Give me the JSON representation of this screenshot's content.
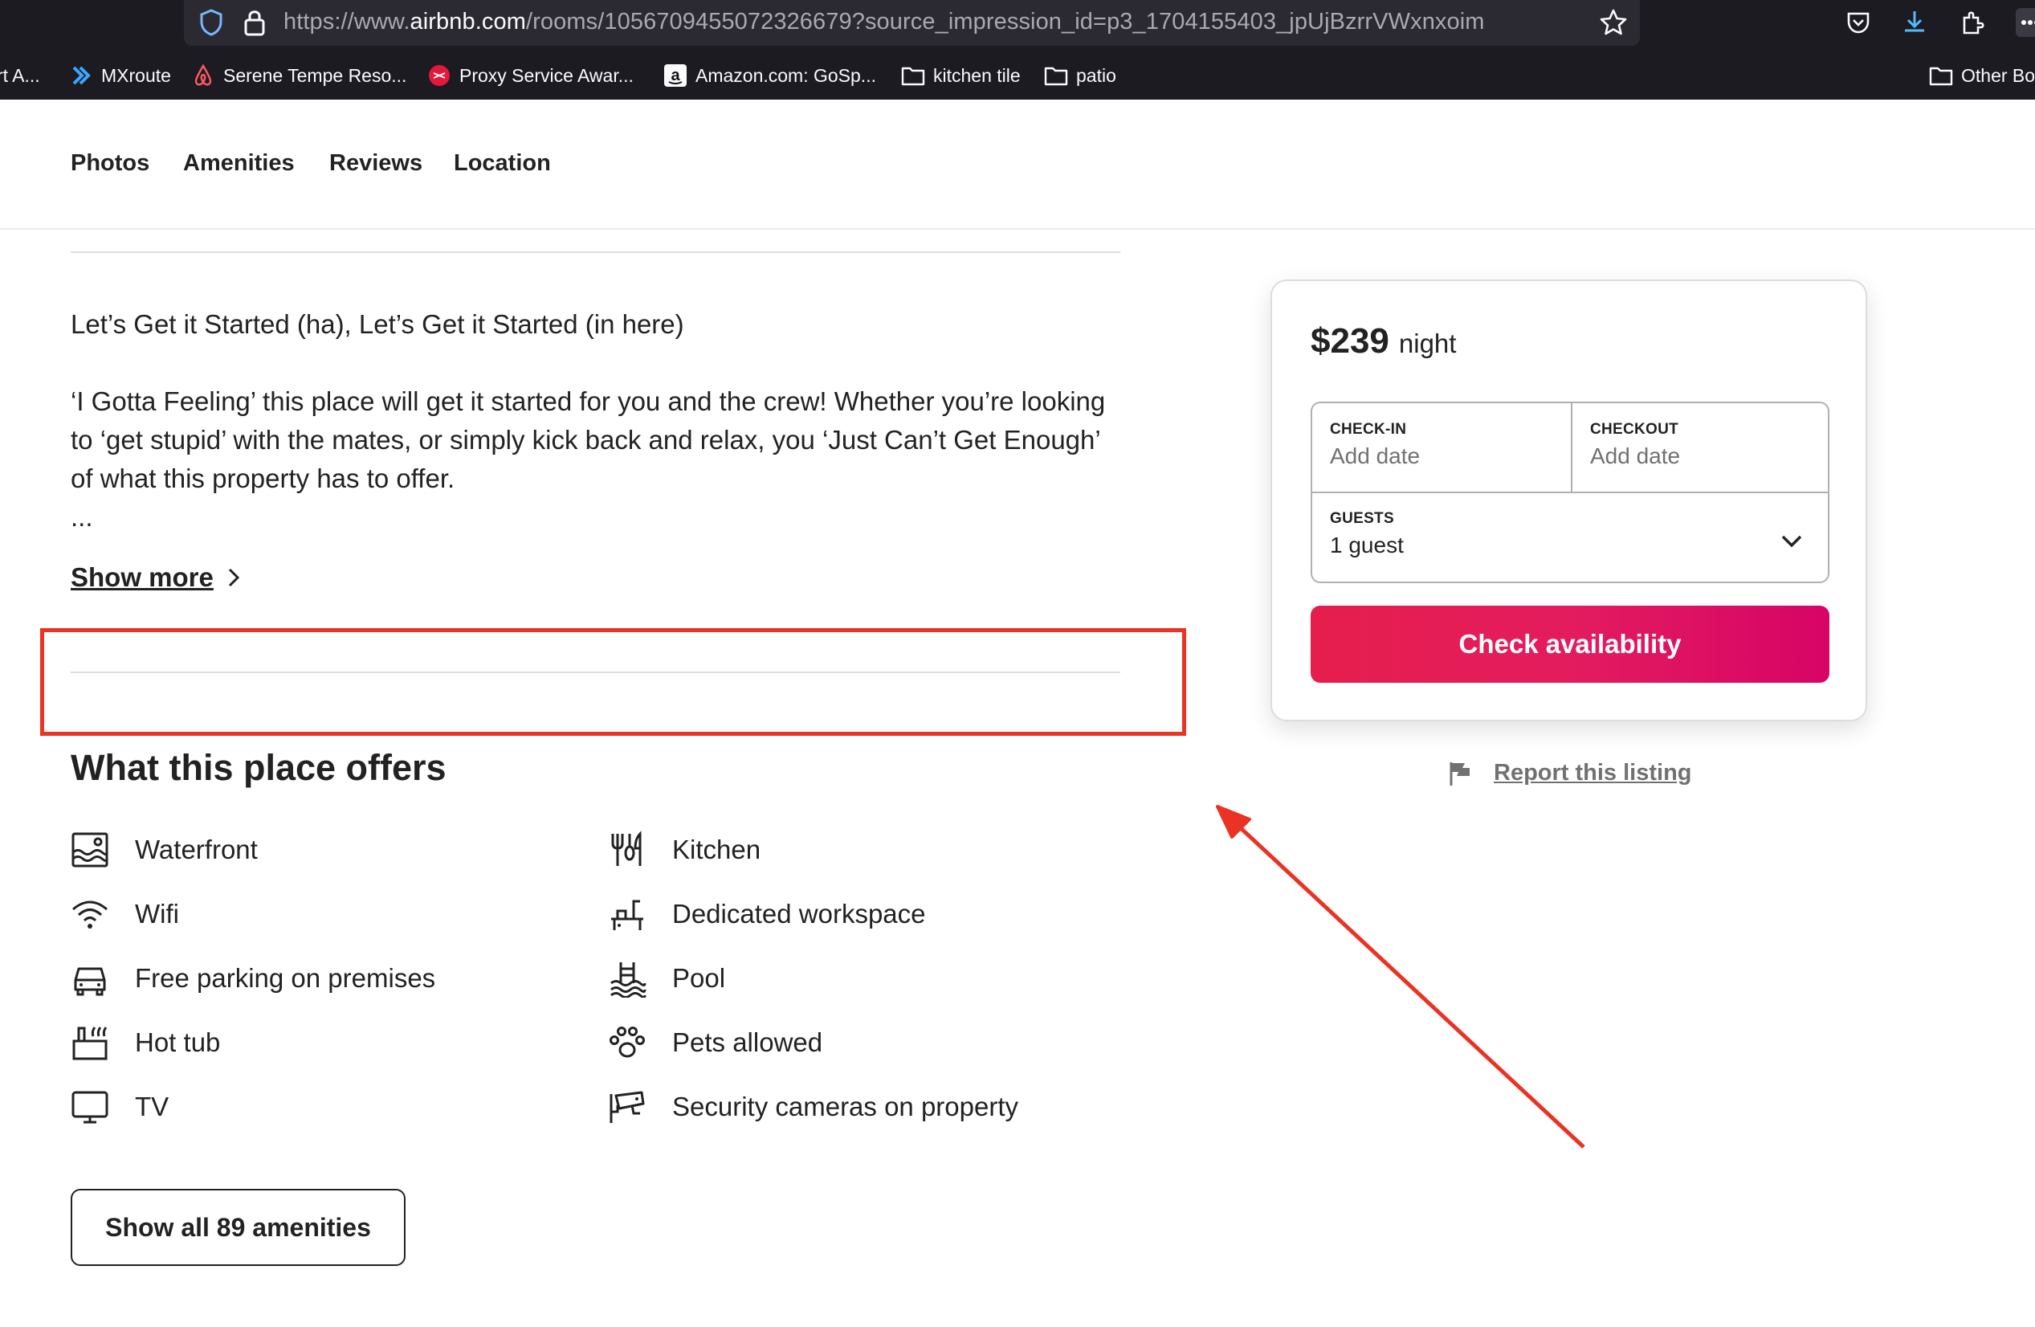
{
  "browser": {
    "url_prefix": "https://www.",
    "url_domain": "airbnb.com",
    "url_rest": "/rooms/1056709455072326679?source_impression_id=p3_1704155403_jpUjBzrrVWxnxoim",
    "bookmarks": [
      {
        "label": "rt A...",
        "icon": "none"
      },
      {
        "label": "MXroute",
        "icon": "mxroute-icon"
      },
      {
        "label": "Serene Tempe Reso...",
        "icon": "airbnb-icon"
      },
      {
        "label": "Proxy Service Awar...",
        "icon": "proxy-icon"
      },
      {
        "label": "Amazon.com: GoSp...",
        "icon": "amazon-icon"
      },
      {
        "label": "kitchen tile",
        "icon": "folder-icon"
      },
      {
        "label": "patio",
        "icon": "folder-icon"
      },
      {
        "label": "Other Bo",
        "icon": "folder-icon"
      }
    ]
  },
  "subnav": {
    "items": [
      "Photos",
      "Amenities",
      "Reviews",
      "Location"
    ]
  },
  "description": {
    "heading_line": "Let’s Get it Started (ha), Let’s Get it Started (in here)",
    "body_line_1": "‘I Gotta Feeling’ this place will get it started for you and the crew! Whether you’re looking",
    "body_line_2": "to ‘get stupid’ with the mates, or simply kick back and relax, you ‘Just Can’t Get Enough’",
    "body_line_3": "of what this property has to offer.",
    "ellipsis": "...",
    "show_more_label": "Show more"
  },
  "offers": {
    "title": "What this place offers",
    "left": [
      {
        "label": "Waterfront",
        "icon": "waterfront-icon"
      },
      {
        "label": "Wifi",
        "icon": "wifi-icon"
      },
      {
        "label": "Free parking on premises",
        "icon": "car-icon"
      },
      {
        "label": "Hot tub",
        "icon": "hot-tub-icon"
      },
      {
        "label": "TV",
        "icon": "tv-icon"
      }
    ],
    "right": [
      {
        "label": "Kitchen",
        "icon": "kitchen-icon"
      },
      {
        "label": "Dedicated workspace",
        "icon": "workspace-icon"
      },
      {
        "label": "Pool",
        "icon": "pool-icon"
      },
      {
        "label": "Pets allowed",
        "icon": "paw-icon"
      },
      {
        "label": "Security cameras on property",
        "icon": "camera-icon"
      }
    ],
    "show_all_label": "Show all 89 amenities"
  },
  "booking": {
    "price": "$239",
    "price_unit": "night",
    "checkin_label": "CHECK-IN",
    "checkin_value": "Add date",
    "checkout_label": "CHECKOUT",
    "checkout_value": "Add date",
    "guests_label": "GUESTS",
    "guests_value": "1 guest",
    "cta_label": "Check availability",
    "accent": "#e31c5f"
  },
  "report": {
    "label": "Report this listing"
  },
  "annotation": {
    "color": "#ea3323"
  }
}
